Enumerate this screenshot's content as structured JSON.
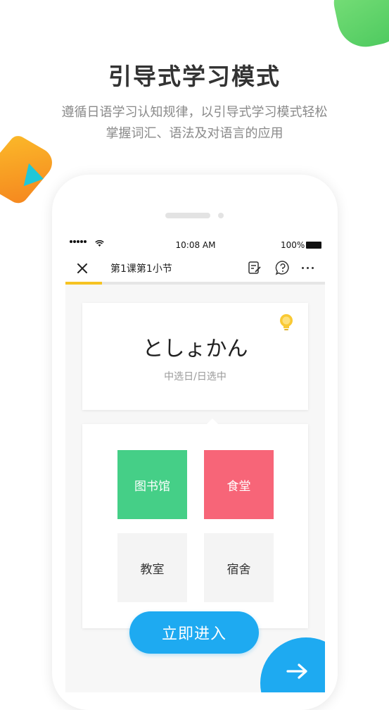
{
  "promo": {
    "headline": "引导式学习模式",
    "subline_1": "遵循日语学习认知规律，以引导式学习模式轻松",
    "subline_2": "掌握词汇、语法及对语言的应用"
  },
  "status_bar": {
    "time": "10:08 AM",
    "battery": "100%"
  },
  "nav": {
    "title": "第1课第1小节"
  },
  "progress": {
    "fraction": 0.14
  },
  "question": {
    "word": "としょかん",
    "hint": "中选日/日选中"
  },
  "options": [
    {
      "label": "图书馆",
      "color": "#45cf87"
    },
    {
      "label": "食堂",
      "color": "#f76578"
    },
    {
      "label": "教室",
      "color": "#f4f4f4"
    },
    {
      "label": "宿舍",
      "color": "#f4f4f4"
    }
  ],
  "enter_button": {
    "label": "立即进入"
  },
  "colors": {
    "accent_blue": "#1eaaf1",
    "progress_yellow": "#f6c323"
  }
}
